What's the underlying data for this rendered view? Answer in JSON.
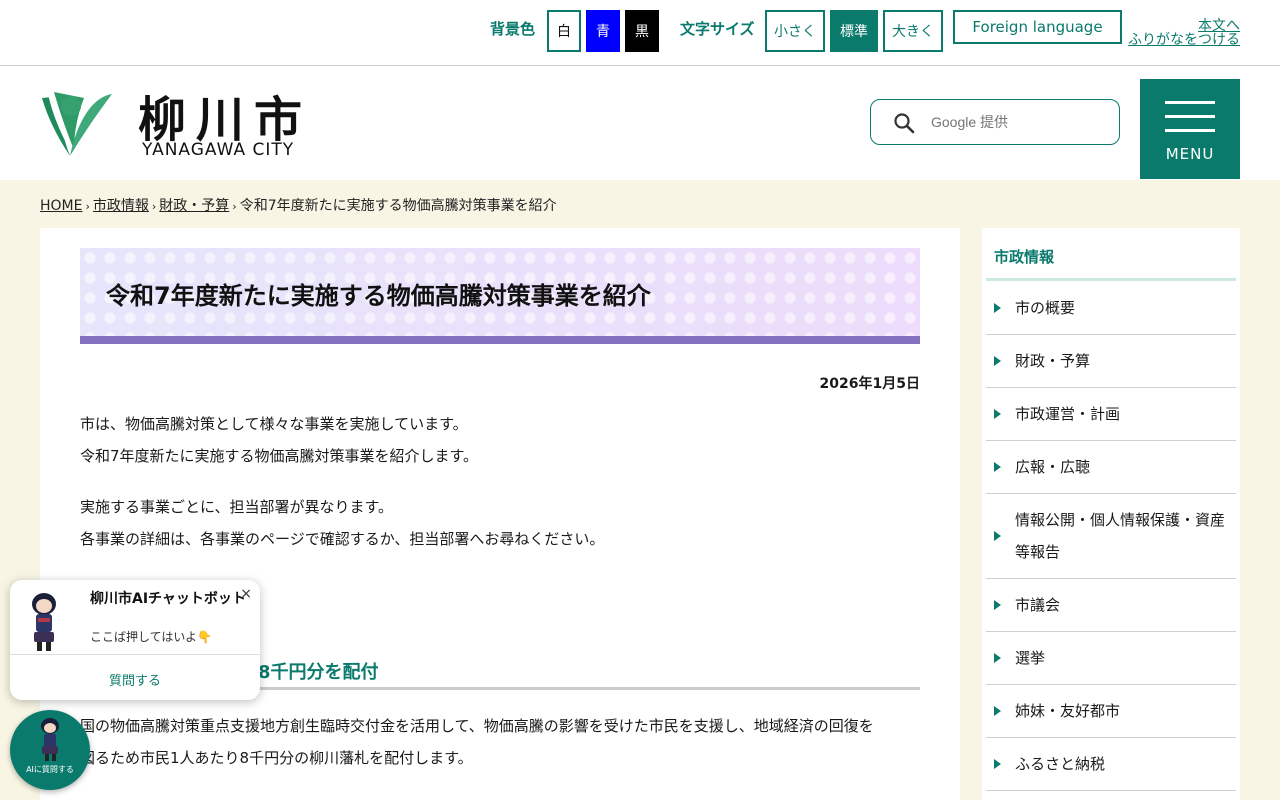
{
  "topbar": {
    "bg_label": "背景色",
    "bg_white": "白",
    "bg_blue": "青",
    "bg_black": "黒",
    "size_label": "文字サイズ",
    "size_small": "小さく",
    "size_standard": "標準",
    "size_large": "大きく",
    "foreign_language": "Foreign language",
    "skip_to_content": "本文へ",
    "furigana": "ふりがなをつける"
  },
  "header": {
    "logo_jp": "柳川市",
    "logo_en": "YANAGAWA CITY",
    "search_placeholder": "Google 提供",
    "menu_label": "MENU"
  },
  "breadcrumb": {
    "home": "HOME",
    "level1": "市政情報",
    "level2": "財政・予算",
    "current": "令和7年度新たに実施する物価高騰対策事業を紹介"
  },
  "article": {
    "title": "令和7年度新たに実施する物価高騰対策事業を紹介",
    "date": "2026年1月5日",
    "para1_line1": "市は、物価高騰対策として様々な事業を実施しています。",
    "para1_line2": "令和7年度新たに実施する物価高騰対策事業を紹介します。",
    "para2_line1": "実施する事業ごとに、担当部署が異なります。",
    "para2_line2": "各事業の詳細は、各事業のページで確認するか、担当部署へお尋ねください。",
    "section_heading_visible": "8千円分を配付",
    "para3_line1": "国の物価高騰対策重点支援地方創生臨時交付金を活用して、物価高騰の影響を受けた市民を支援し、地域経済の回復を",
    "para3_line2": "図るため市民1人あたり8千円分の柳川藩札を配付します。"
  },
  "sidebar": {
    "title": "市政情報",
    "items": [
      {
        "label": "市の概要"
      },
      {
        "label": "財政・予算"
      },
      {
        "label": "市政運営・計画"
      },
      {
        "label": "広報・広聴"
      },
      {
        "label": "情報公開・個人情報保護・資産等報告"
      },
      {
        "label": "市議会"
      },
      {
        "label": "選挙"
      },
      {
        "label": "姉妹・友好都市"
      },
      {
        "label": "ふるさと納税"
      }
    ]
  },
  "chatbot": {
    "title": "柳川市AIチャットボット",
    "subtitle": "ここば押してはいよ👇",
    "close": "×",
    "ask": "質問する",
    "fab_label": "AIに質問する"
  },
  "colors": {
    "brand_green": "#0a7a6c",
    "title_underline": "#8471c0",
    "page_background": "#f8f5e4"
  }
}
